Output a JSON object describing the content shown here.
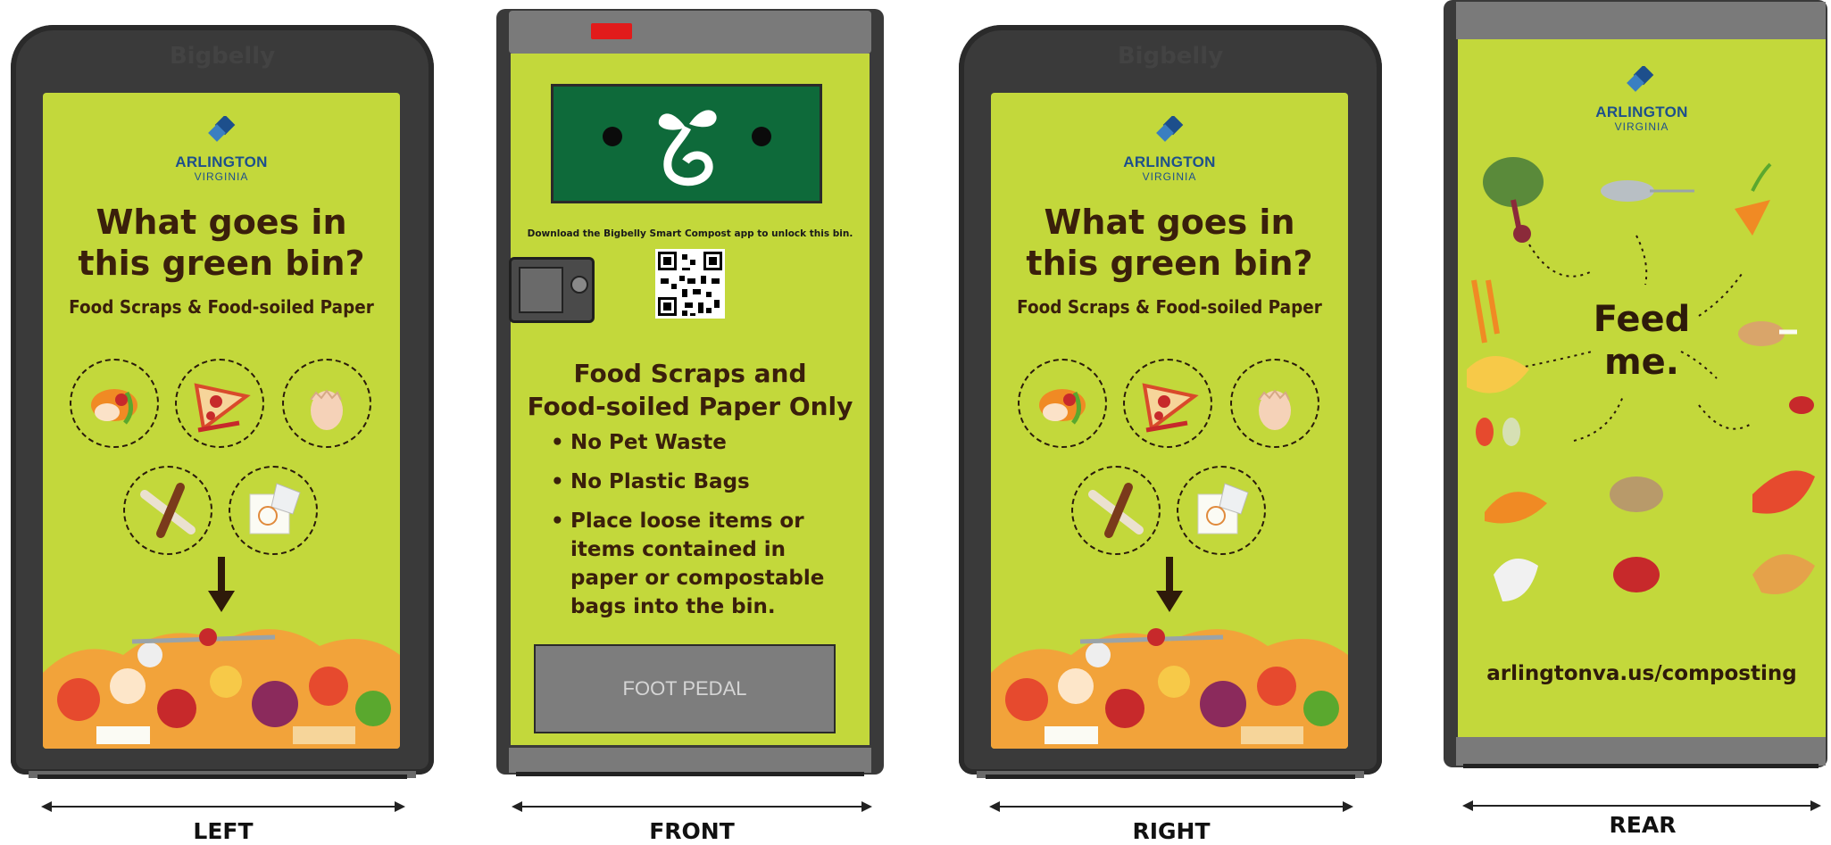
{
  "views": {
    "left": "LEFT",
    "front": "FRONT",
    "right": "RIGHT",
    "rear": "REAR"
  },
  "brand": {
    "bigbelly": "Bigbelly"
  },
  "side_panel": {
    "org_name": "ARLINGTON",
    "org_sub": "VIRGINIA",
    "headline_1": "What goes in",
    "headline_2": "this green bin?",
    "subhead": "Food Scraps & Food-soiled Paper"
  },
  "front_panel": {
    "download_text": "Download the Bigbelly Smart Compost app to unlock this bin.",
    "title_1": "Food Scraps and",
    "title_2": "Food-soiled Paper Only",
    "rules": [
      "No Pet Waste",
      "No Plastic Bags",
      "Place loose items or items contained in paper or compostable bags into the bin."
    ],
    "foot_pedal": "FOOT PEDAL"
  },
  "rear_panel": {
    "org_name": "ARLINGTON",
    "org_sub": "VIRGINIA",
    "feed_1": "Feed",
    "feed_2": "me.",
    "url": "arlingtonva.us/composting"
  },
  "colors": {
    "panel_green": "#c3d83b",
    "shell_gray": "#3a3a3a",
    "display_green": "#0e6a3a",
    "text_brown": "#3a1f0b",
    "arlington_blue": "#1d4f8c",
    "indicator_red": "#e21b1b"
  }
}
